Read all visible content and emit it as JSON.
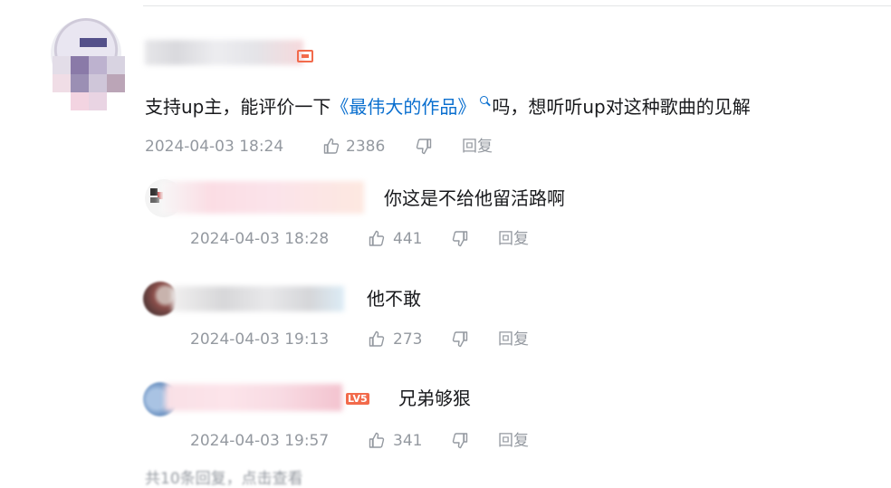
{
  "main_comment": {
    "text_before": "支持up主，能评价一下",
    "link_text": "《最伟大的作品》",
    "text_after": "吗，想听听up对这种歌曲的见解",
    "time": "2024-04-03 18:24",
    "likes": "2386",
    "reply_label": "回复"
  },
  "replies": [
    {
      "text": "你这是不给他留活路啊",
      "time": "2024-04-03 18:28",
      "likes": "441",
      "reply_label": "回复"
    },
    {
      "text": "他不敢",
      "time": "2024-04-03 19:13",
      "likes": "273",
      "reply_label": "回复"
    },
    {
      "text": "兄弟够狠",
      "time": "2024-04-03 19:57",
      "likes": "341",
      "reply_label": "回复",
      "level_badge": "LV5"
    }
  ],
  "more_replies": "共10条回复，点击查看",
  "icons": {
    "like": "thumb-up-icon",
    "dislike": "thumb-down-icon",
    "search": "search-icon",
    "level": "level-badge-icon"
  },
  "colors": {
    "link": "#0a6fcf",
    "meta": "#9499a0",
    "badge": "#f26a4b",
    "text": "#18191c"
  }
}
